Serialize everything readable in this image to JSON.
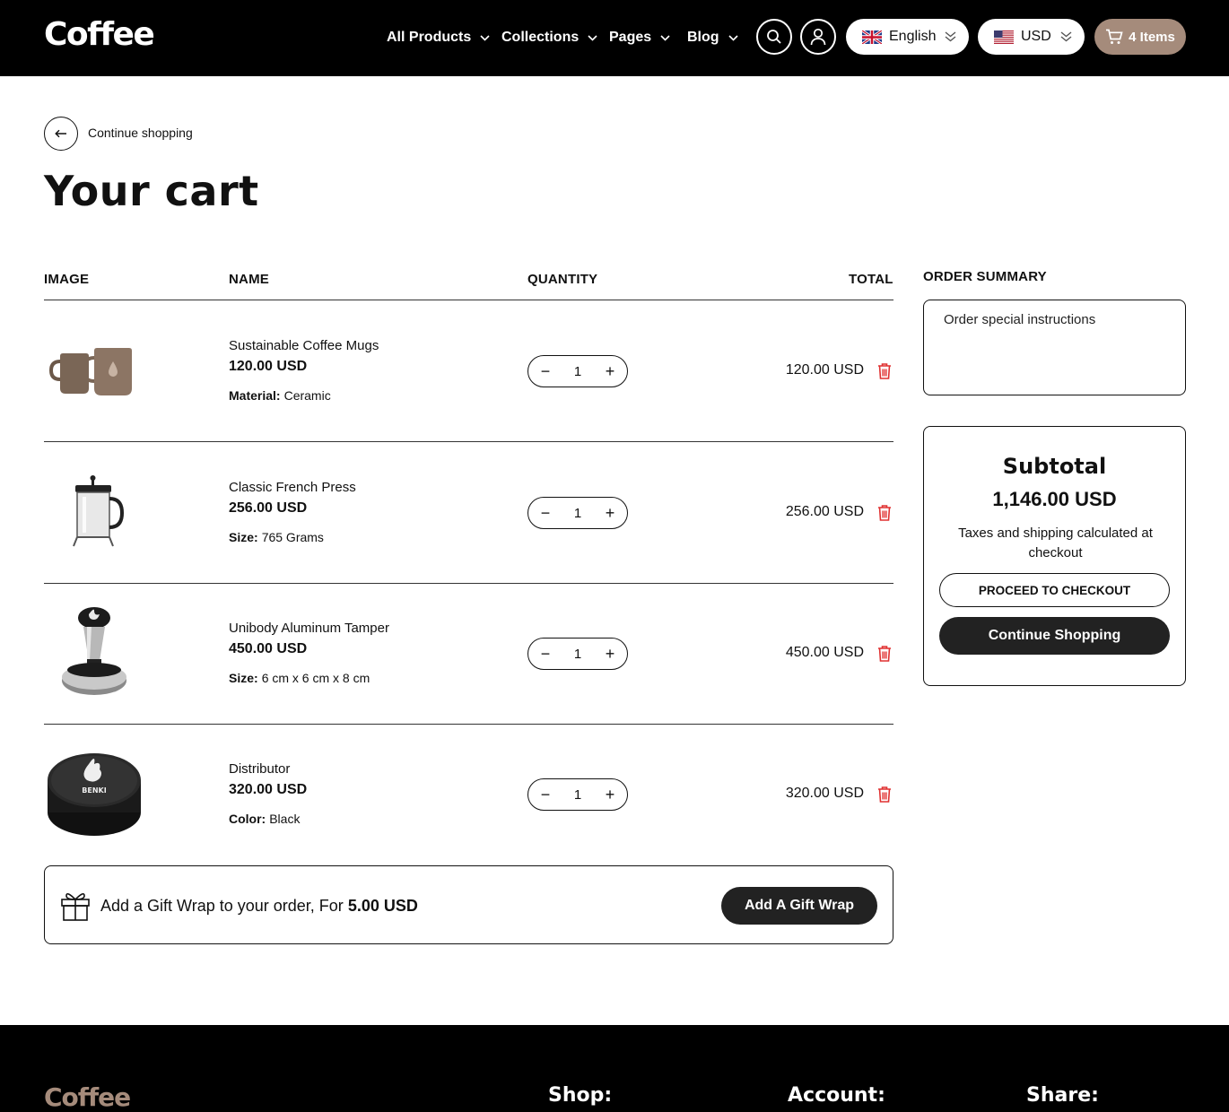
{
  "header": {
    "logo": "Coffee",
    "nav": [
      "All Products",
      "Collections",
      "Pages",
      "Blog"
    ],
    "language": "English",
    "currency": "USD",
    "cart_count": "4 Items"
  },
  "back": {
    "label": "Continue shopping"
  },
  "page_title": "Your cart",
  "table": {
    "headers": {
      "image": "IMAGE",
      "name": "NAME",
      "quantity": "QUANTITY",
      "total": "TOTAL"
    },
    "items": [
      {
        "name": "Sustainable Coffee Mugs",
        "price": "120.00 USD",
        "option_label": "Material:",
        "option_value": "Ceramic",
        "quantity": "1",
        "total": "120.00 USD",
        "image": "coffee-mugs-image"
      },
      {
        "name": "Classic French Press",
        "price": "256.00 USD",
        "option_label": "Size:",
        "option_value": "765 Grams",
        "quantity": "1",
        "total": "256.00 USD",
        "image": "french-press-image"
      },
      {
        "name": "Unibody Aluminum Tamper",
        "price": "450.00 USD",
        "option_label": "Size:",
        "option_value": "6 cm x 6 cm x 8 cm",
        "quantity": "1",
        "total": "450.00 USD",
        "image": "tamper-image"
      },
      {
        "name": "Distributor",
        "price": "320.00 USD",
        "option_label": "Color:",
        "option_value": "Black",
        "quantity": "1",
        "total": "320.00 USD",
        "image": "distributor-image"
      }
    ]
  },
  "gift": {
    "text": "Add a Gift Wrap to your order, For",
    "price": "5.00 USD",
    "button": "Add A Gift Wrap"
  },
  "summary": {
    "title": "ORDER SUMMARY",
    "instructions_placeholder": "Order special instructions",
    "subtotal_label": "Subtotal",
    "subtotal_value": "1,146.00 USD",
    "note": "Taxes and shipping calculated at checkout",
    "checkout_button": "PROCEED TO CHECKOUT",
    "continue_button": "Continue Shopping"
  },
  "footer": {
    "logo": "Coffee",
    "columns": [
      "Shop:",
      "Account:",
      "Share:"
    ]
  },
  "colors": {
    "header_bg": "#000000",
    "accent": "#a58b7b",
    "trash": "#e03131",
    "button_dark": "#222222"
  }
}
